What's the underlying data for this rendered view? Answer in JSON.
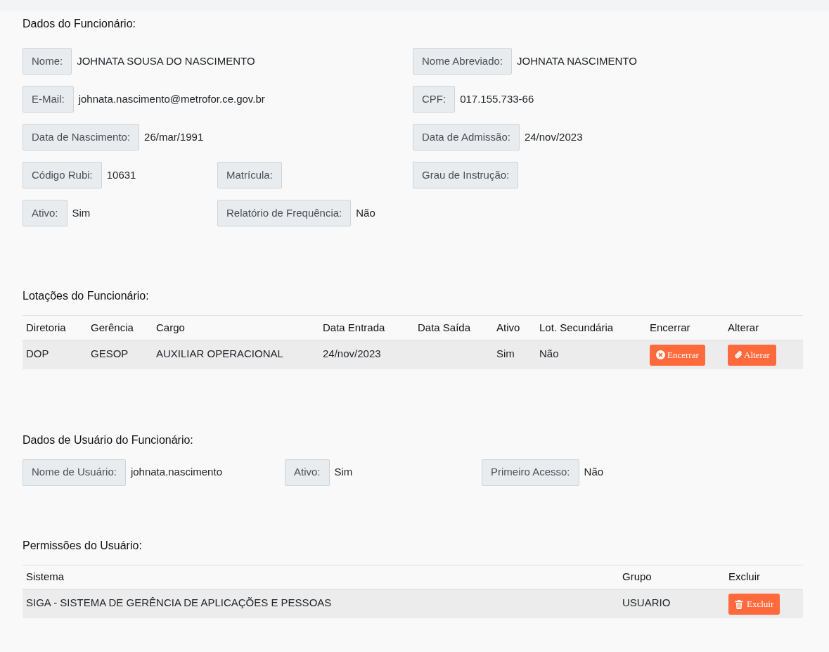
{
  "employee": {
    "title": "Dados do Funcionário:",
    "rows": [
      {
        "left": {
          "label": "Nome:",
          "value": "JOHNATA SOUSA DO NASCIMENTO"
        },
        "right": {
          "label": "Nome Abreviado:",
          "value": "JOHNATA NASCIMENTO"
        }
      },
      {
        "left": {
          "label": "E-Mail:",
          "value": "johnata.nascimento@metrofor.ce.gov.br"
        },
        "right": {
          "label": "CPF:",
          "value": "017.155.733-66"
        }
      },
      {
        "left": {
          "label": "Data de Nascimento:",
          "value": "26/mar/1991"
        },
        "right": {
          "label": "Data de Admissão:",
          "value": "24/nov/2023"
        }
      },
      {
        "left": {
          "label": "Código Rubi:",
          "value": "10631"
        },
        "middle": {
          "label": "Matrícula:"
        },
        "right": {
          "label": "Grau de Instrução:"
        }
      },
      {
        "left": {
          "label": "Ativo:",
          "value": "Sim"
        },
        "middle": {
          "label": "Relatório de Frequência:",
          "value": "Não"
        }
      }
    ]
  },
  "allocations": {
    "title": "Lotações do Funcionário:",
    "columns": [
      "Diretoria",
      "Gerência",
      "Cargo",
      "Data Entrada",
      "Data Saída",
      "Ativo",
      "Lot. Secundária",
      "Encerrar",
      "Alterar"
    ],
    "rows": [
      {
        "cells": [
          "DOP",
          "GESOP",
          "AUXILIAR OPERACIONAL",
          "24/nov/2023",
          "",
          "Sim",
          "Não"
        ],
        "end_button": "Encerrar",
        "edit_button": "Alterar"
      }
    ]
  },
  "user": {
    "title": "Dados de Usuário do Funcionário:",
    "fields": [
      {
        "label": "Nome de Usuário:",
        "value": "johnata.nascimento"
      },
      {
        "label": "Ativo:",
        "value": "Sim"
      },
      {
        "label": "Primeiro Acesso:",
        "value": "Não"
      }
    ]
  },
  "permissions": {
    "title": "Permissões do Usuário:",
    "columns": [
      "Sistema",
      "Grupo",
      "Excluir"
    ],
    "rows": [
      {
        "system": "SIGA - SISTEMA DE GERÊNCIA DE APLICAÇÕES E PESSOAS",
        "group": "USUARIO",
        "delete_button": "Excluir"
      }
    ]
  }
}
